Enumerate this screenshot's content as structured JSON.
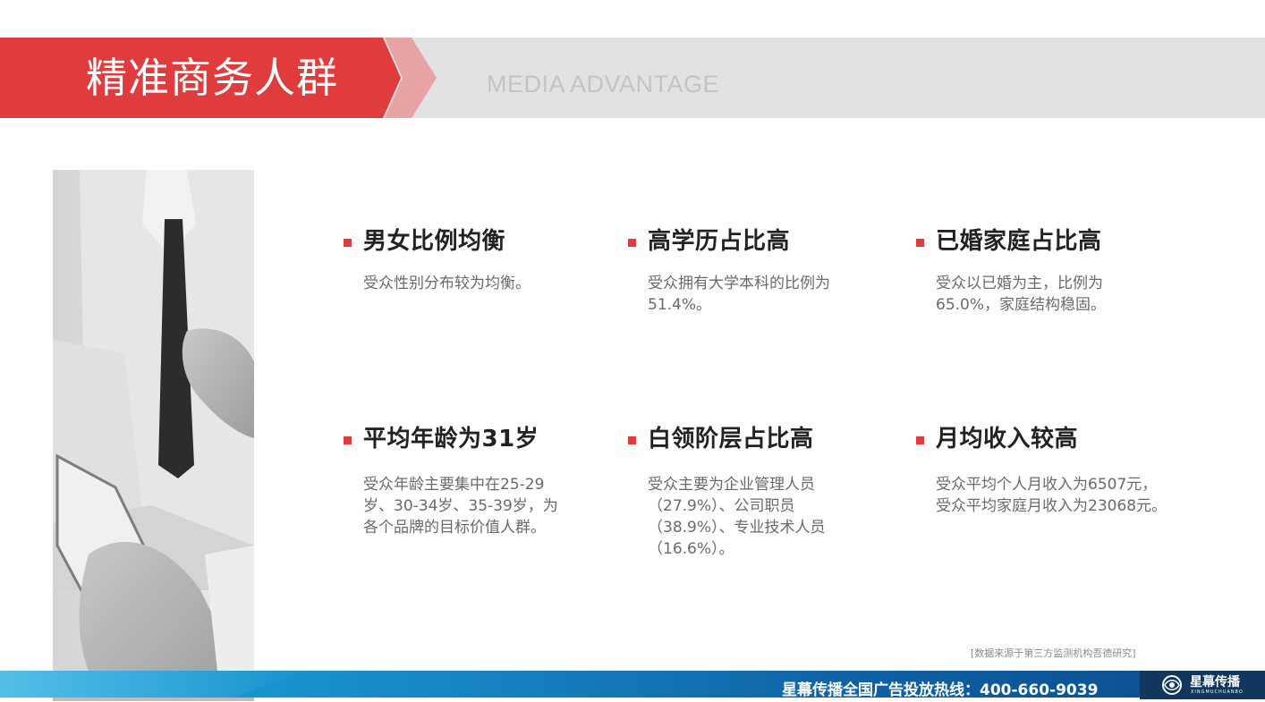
{
  "header": {
    "title": "精准商务人群",
    "subtitle": "MEDIA ADVANTAGE"
  },
  "features": [
    {
      "title": "男女比例均衡",
      "body": "受众性别分布较为均衡。"
    },
    {
      "title": "高学历占比高",
      "body": "受众拥有大学本科的比例为51.4%。"
    },
    {
      "title": "已婚家庭占比高",
      "body": "受众以已婚为主，比例为65.0%，家庭结构稳固。"
    },
    {
      "title": "平均年龄为31岁",
      "body": "受众年龄主要集中在25-29岁、30-34岁、35-39岁，为各个品牌的目标价值人群。"
    },
    {
      "title": "白领阶层占比高",
      "body": "受众主要为企业管理人员（27.9%）、公司职员（38.9%）、专业技术人员（16.6%）。"
    },
    {
      "title": "月均收入较高",
      "body": "受众平均个人月收入为6507元，受众平均家庭月收入为23068元。"
    }
  ],
  "source_note": "[数据来源于第三方监测机构吾德研究]",
  "footer": {
    "hotline": "星幕传播全国广告投放热线：400-660-9039",
    "logo_name": "星幕传播",
    "logo_pinyin": "XINGMUCHUANBO"
  },
  "colors": {
    "accent": "#e03c3e",
    "header_gray": "#e2e2e2",
    "footer_blue": "#1786c4",
    "logo_navy": "#12375e"
  }
}
